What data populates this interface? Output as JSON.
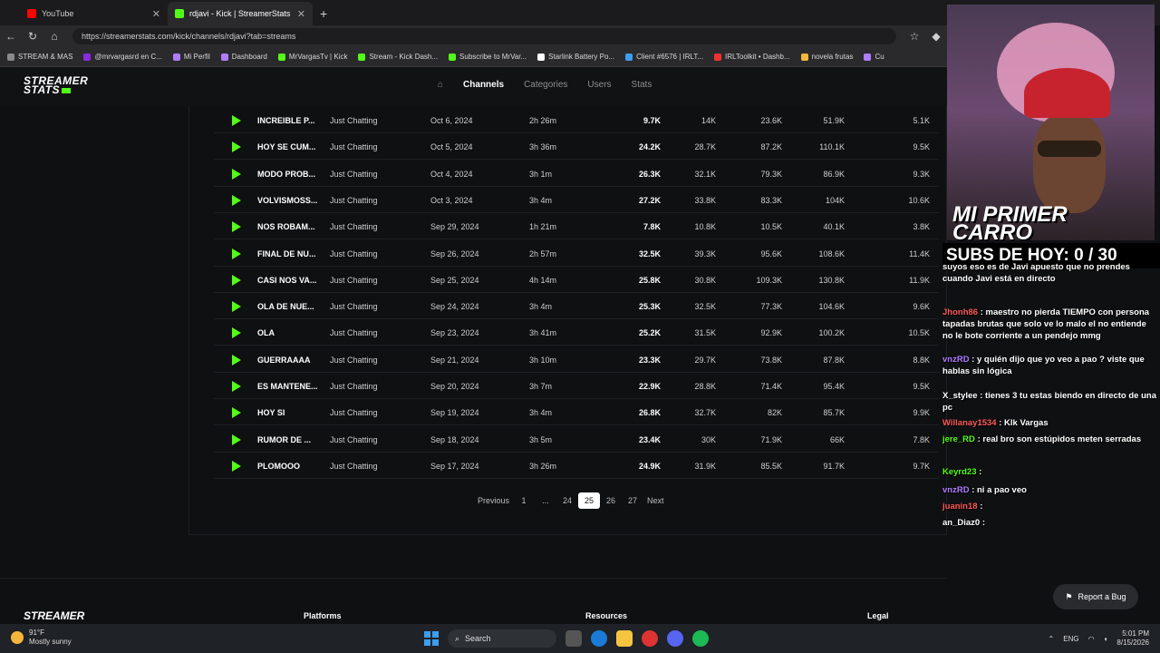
{
  "browser": {
    "tabs": [
      {
        "label": "YouTube",
        "color": "#ff0000"
      },
      {
        "label": "rdjavi - Kick | StreamerStats",
        "color": "#53fc18"
      }
    ],
    "url": "https://streamerstats.com/kick/channels/rdjavi?tab=streams",
    "bookmarks": [
      "STREAM & MAS",
      "@mrvargasrd en C...",
      "Mi Perfil",
      "Dashboard",
      "MrVargasTv | Kick",
      "Stream - Kick Dash...",
      "Subscribe to MrVar...",
      "Starlink Battery Po...",
      "Client #6576 | IRLT...",
      "IRLToolkit • Dashb...",
      "novela frutas",
      "Cu"
    ]
  },
  "site": {
    "logo_line1": "STREAMER",
    "logo_line2": "STATS",
    "nav": {
      "channels": "Channels",
      "categories": "Categories",
      "users": "Users",
      "stats": "Stats"
    }
  },
  "rows": [
    {
      "title": "INCREIBLE P...",
      "category": "Just Chatting",
      "date": "Oct 6, 2024",
      "duration": "2h 26m",
      "avg": "9.7K",
      "peak": "14K",
      "hours": "23.6K",
      "watch": "51.9K",
      "followers": "5.1K"
    },
    {
      "title": "HOY SE CUM...",
      "category": "Just Chatting",
      "date": "Oct 5, 2024",
      "duration": "3h 36m",
      "avg": "24.2K",
      "peak": "28.7K",
      "hours": "87.2K",
      "watch": "110.1K",
      "followers": "9.5K"
    },
    {
      "title": "MODO PROB...",
      "category": "Just Chatting",
      "date": "Oct 4, 2024",
      "duration": "3h 1m",
      "avg": "26.3K",
      "peak": "32.1K",
      "hours": "79.3K",
      "watch": "86.9K",
      "followers": "9.3K"
    },
    {
      "title": "VOLVISMOSS...",
      "category": "Just Chatting",
      "date": "Oct 3, 2024",
      "duration": "3h 4m",
      "avg": "27.2K",
      "peak": "33.8K",
      "hours": "83.3K",
      "watch": "104K",
      "followers": "10.6K"
    },
    {
      "title": "NOS ROBAM...",
      "category": "Just Chatting",
      "date": "Sep 29, 2024",
      "duration": "1h 21m",
      "avg": "7.8K",
      "peak": "10.8K",
      "hours": "10.5K",
      "watch": "40.1K",
      "followers": "3.8K"
    },
    {
      "title": "FINAL DE NU...",
      "category": "Just Chatting",
      "date": "Sep 26, 2024",
      "duration": "2h 57m",
      "avg": "32.5K",
      "peak": "39.3K",
      "hours": "95.6K",
      "watch": "108.6K",
      "followers": "11.4K"
    },
    {
      "title": "CASI NOS VA...",
      "category": "Just Chatting",
      "date": "Sep 25, 2024",
      "duration": "4h 14m",
      "avg": "25.8K",
      "peak": "30.8K",
      "hours": "109.3K",
      "watch": "130.8K",
      "followers": "11.9K"
    },
    {
      "title": "OLA DE NUE...",
      "category": "Just Chatting",
      "date": "Sep 24, 2024",
      "duration": "3h 4m",
      "avg": "25.3K",
      "peak": "32.5K",
      "hours": "77.3K",
      "watch": "104.6K",
      "followers": "9.6K"
    },
    {
      "title": "OLA",
      "category": "Just Chatting",
      "date": "Sep 23, 2024",
      "duration": "3h 41m",
      "avg": "25.2K",
      "peak": "31.5K",
      "hours": "92.9K",
      "watch": "100.2K",
      "followers": "10.5K"
    },
    {
      "title": "GUERRAAAA",
      "category": "Just Chatting",
      "date": "Sep 21, 2024",
      "duration": "3h 10m",
      "avg": "23.3K",
      "peak": "29.7K",
      "hours": "73.8K",
      "watch": "87.8K",
      "followers": "8.8K"
    },
    {
      "title": "ES MANTENE...",
      "category": "Just Chatting",
      "date": "Sep 20, 2024",
      "duration": "3h 7m",
      "avg": "22.9K",
      "peak": "28.8K",
      "hours": "71.4K",
      "watch": "95.4K",
      "followers": "9.5K"
    },
    {
      "title": "HOY SI",
      "category": "Just Chatting",
      "date": "Sep 19, 2024",
      "duration": "3h 4m",
      "avg": "26.8K",
      "peak": "32.7K",
      "hours": "82K",
      "watch": "85.7K",
      "followers": "9.9K"
    },
    {
      "title": "RUMOR DE ...",
      "category": "Just Chatting",
      "date": "Sep 18, 2024",
      "duration": "3h 5m",
      "avg": "23.4K",
      "peak": "30K",
      "hours": "71.9K",
      "watch": "66K",
      "followers": "7.8K"
    },
    {
      "title": "PLOMOOO",
      "category": "Just Chatting",
      "date": "Sep 17, 2024",
      "duration": "3h 26m",
      "avg": "24.9K",
      "peak": "31.9K",
      "hours": "85.5K",
      "watch": "91.7K",
      "followers": "9.7K"
    }
  ],
  "pagination": {
    "previous": "Previous",
    "first": "1",
    "ellipsis": "...",
    "p24": "24",
    "current": "25",
    "p26": "26",
    "p27": "27",
    "next": "Next"
  },
  "footer": {
    "platforms": "Platforms",
    "resources": "Resources",
    "legal": "Legal",
    "report_bug": "Report a Bug"
  },
  "stream": {
    "overlay_text_1": "MI PRIMER",
    "overlay_text_2": "CARRO",
    "subs_banner": "SUBS DE HOY: 0 / 30",
    "chat": [
      {
        "user": "",
        "text": "suyos eso es de Javi apuesto que no prendes cuando Javi está en directo",
        "color": "#ffffff"
      },
      {
        "user": "Jhonh86",
        "text": ": maestro no pierda TIEMPO con persona tapadas brutas que solo ve lo malo el no entiende no le bote corriente a un pendejo mmg",
        "color": "#ff5a5a"
      },
      {
        "user": "vnzRD",
        "text": ": y quién dijo que yo veo a pao ? viste que hablas sin lógica",
        "color": "#b07cff"
      },
      {
        "user": "X_stylee",
        "text": ": tienes 3 tu estas biendo en directo de una pc",
        "color": "#ffffff"
      },
      {
        "user": "Willanay1534",
        "text": ": Klk Vargas",
        "color": "#ff5a5a"
      },
      {
        "user": "jere_RD",
        "text": ": real bro son estúpidos meten serradas",
        "color": "#53fc18"
      },
      {
        "user": "Keyrd23",
        "text": ":",
        "color": "#53fc18"
      },
      {
        "user": "vnzRD",
        "text": ": ni a pao veo",
        "color": "#b07cff"
      },
      {
        "user": "juanin18",
        "text": ":",
        "color": "#ff5a5a"
      },
      {
        "user": "an_Diaz0",
        "text": ":",
        "color": "#ffffff"
      }
    ]
  },
  "taskbar": {
    "temp": "91°F",
    "weather": "Mostly sunny",
    "search": "Search",
    "lang": "ENG",
    "time": "5:01 PM",
    "date": "8/15/2026"
  }
}
